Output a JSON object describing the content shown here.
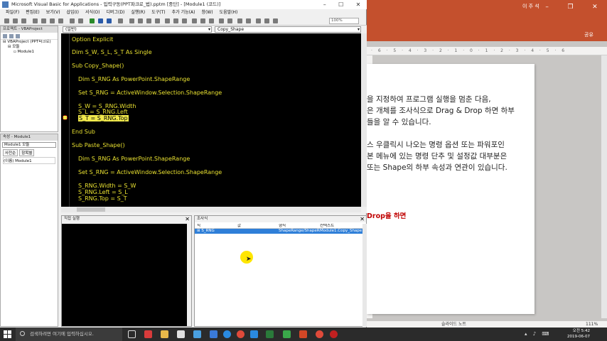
{
  "vba": {
    "title": "Microsoft Visual Basic for Applications - 입력구동(PPT파크로_법).pptm [중단] - [Module1 (코드)]",
    "menu": [
      "파일(F)",
      "편집(E)",
      "보기(V)",
      "삽입(I)",
      "서식(O)",
      "디버그(D)",
      "실행(R)",
      "도구(T)",
      "추가 기능(A)",
      "창(W)",
      "도움말(H)"
    ],
    "toolbar_zoom": "100%",
    "project_title": "프로젝트 - VBAProject",
    "project_tree": [
      "VBAProject (PPT파크로)",
      "모듈",
      "Module1"
    ],
    "properties_title": "속성 - Module1",
    "properties_combo": "Module1 모듈",
    "properties_tabs": [
      "사전순",
      "항목별"
    ],
    "properties_row": "(이름) Module1",
    "combo_left": "(일반)",
    "combo_right": "Copy_Shape",
    "code_lines": [
      {
        "text": "Option Explicit",
        "indent": 0
      },
      {
        "text": "Dim S_W, S_L, S_T As Single",
        "indent": 0
      },
      {
        "text": "Sub Copy_Shape()",
        "indent": 0
      },
      {
        "text": "Dim S_RNG As PowerPoint.ShapeRange",
        "indent": 1
      },
      {
        "text": "Set S_RNG = ActiveWindow.Selection.ShapeRange",
        "indent": 1
      },
      {
        "text": "S_W = S_RNG.Width",
        "indent": 1
      },
      {
        "text": "S_L = S_RNG.Left",
        "indent": 1
      },
      {
        "text": "S_T = S_RNG.Top",
        "indent": 1
      },
      {
        "text": "End Sub",
        "indent": 0
      },
      {
        "text": "Sub Paste_Shape()",
        "indent": 0
      },
      {
        "text": "Dim S_RNG As PowerPoint.ShapeRange",
        "indent": 1
      },
      {
        "text": "Set S_RNG = ActiveWindow.Selection.ShapeRange",
        "indent": 1
      },
      {
        "text": "S_RNG.Width = S_W",
        "indent": 1
      },
      {
        "text": "S_RNG.Left = S_L",
        "indent": 1
      },
      {
        "text": "S_RNG.Top = S_T",
        "indent": 1
      }
    ],
    "immediate_title": "직접 실행",
    "locals_title": "조사식",
    "locals_columns": [
      "식",
      "값",
      "형식",
      "컨텍스트"
    ],
    "locals_row": [
      "S_RNG",
      "",
      "ShapeRange/ShapeRa",
      "Module1.Copy_Shape"
    ]
  },
  "ppt": {
    "user": "이 주 석",
    "share": "공유",
    "ruler": "· 6 · 5 · 4 · 3 · 2 · 1 · 0 · 1 · 2 · 3 · 4 · 5 · 6",
    "slide_lines": [
      "을 지정하여 프로그램 실행을 멈춘 다음,",
      "은 개체를 조사식으로 Drag & Drop 하면 하부",
      "들을 알 수 있습니다.",
      "",
      "스 우클릭시 나오는 명령 옵션 또는 파워포인",
      "본 메뉴에 있는 명령 단추 및 설정값 대부분은",
      "또는 Shape의 하부 속성과 연관이 있습니다."
    ],
    "slide_red": "Drop을 하면",
    "status_notes": "슬라이드 노트",
    "status_zoom": "111%"
  },
  "taskbar": {
    "search_placeholder": "검색하려면 여기에 입력하십시오.",
    "time": "오전 5:42",
    "date": "2019-06-07"
  }
}
